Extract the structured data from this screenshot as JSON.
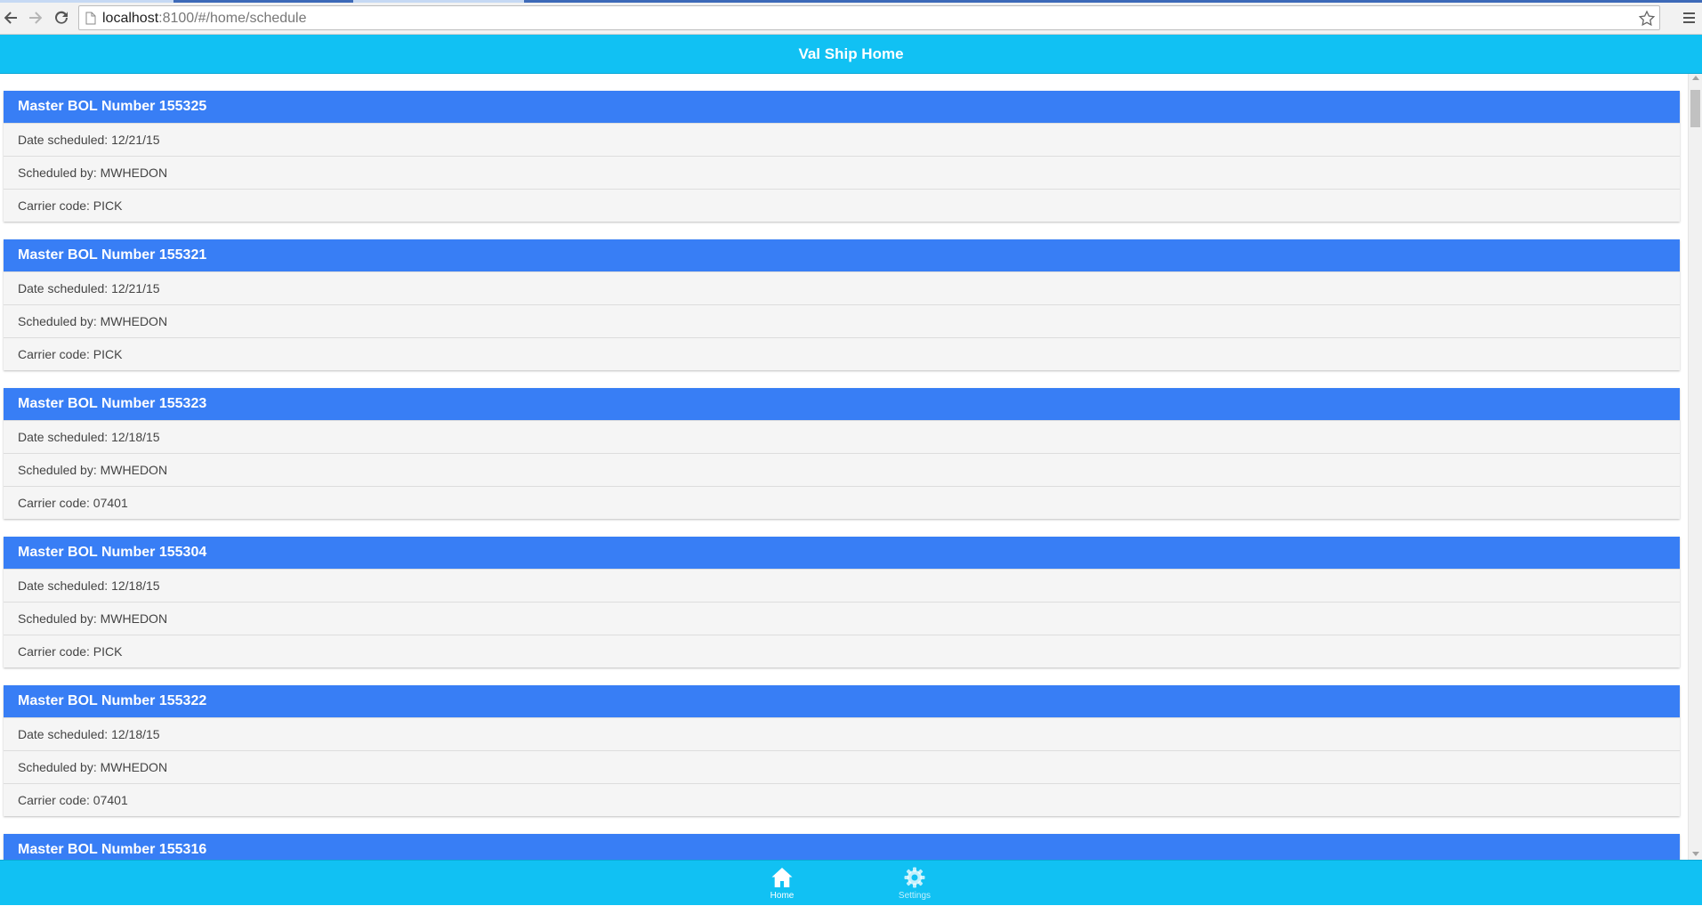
{
  "browser": {
    "url_host": "localhost",
    "url_path": ":8100/#/home/schedule",
    "icons": {
      "back": "back-arrow-icon",
      "forward": "forward-arrow-icon",
      "reload": "reload-icon",
      "page": "page-icon",
      "bookmark": "star-icon",
      "menu": "hamburger-menu-icon"
    }
  },
  "header": {
    "title": "Val Ship Home"
  },
  "labels": {
    "date": "Date scheduled: ",
    "by": "Scheduled by: ",
    "carrier": "Carrier code: "
  },
  "shipments": [
    {
      "title": "Master BOL Number 155325",
      "date": "Date scheduled: 12/21/15",
      "by": "Scheduled by: MWHEDON",
      "carrier": "Carrier code: PICK"
    },
    {
      "title": "Master BOL Number 155321",
      "date": "Date scheduled: 12/21/15",
      "by": "Scheduled by: MWHEDON",
      "carrier": "Carrier code: PICK"
    },
    {
      "title": "Master BOL Number 155323",
      "date": "Date scheduled: 12/18/15",
      "by": "Scheduled by: MWHEDON",
      "carrier": "Carrier code: 07401"
    },
    {
      "title": "Master BOL Number 155304",
      "date": "Date scheduled: 12/18/15",
      "by": "Scheduled by: MWHEDON",
      "carrier": "Carrier code: PICK"
    },
    {
      "title": "Master BOL Number 155322",
      "date": "Date scheduled: 12/18/15",
      "by": "Scheduled by: MWHEDON",
      "carrier": "Carrier code: 07401"
    },
    {
      "title": "Master BOL Number 155316"
    }
  ],
  "tabs": [
    {
      "label": "Home",
      "icon": "home-icon",
      "active": true
    },
    {
      "label": "Settings",
      "icon": "gear-icon",
      "active": false
    }
  ],
  "colors": {
    "header_bg": "#11c1f3",
    "card_header_bg": "#387ef5",
    "card_body_bg": "#f5f5f5"
  }
}
